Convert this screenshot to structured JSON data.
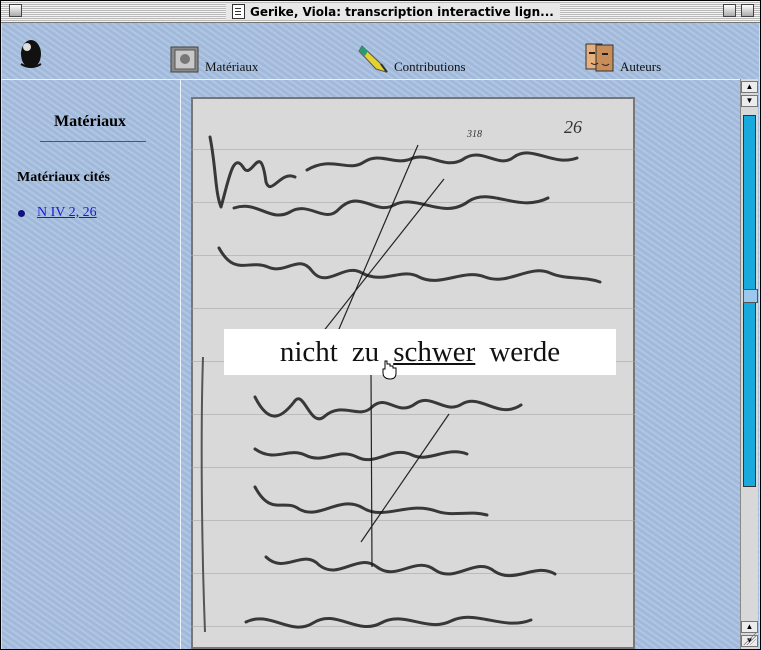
{
  "window": {
    "title": "Gerike, Viola: transcription interactive lign..."
  },
  "nav": {
    "materiaux": "Matériaux",
    "contributions": "Contributions",
    "auteurs": "Auteurs"
  },
  "sidebar": {
    "title": "Matériaux",
    "subtitle": "Matériaux cités",
    "link": "N IV 2, 26"
  },
  "document": {
    "page_number": "26",
    "line_number": "318",
    "transcription": {
      "w1": "nicht",
      "w2": "zu",
      "w3": "schwer",
      "w4": "werde"
    }
  },
  "icons": [
    "document-icon",
    "logo-icon",
    "safe-icon",
    "pen-icon",
    "faces-icon",
    "hand-cursor-icon"
  ]
}
